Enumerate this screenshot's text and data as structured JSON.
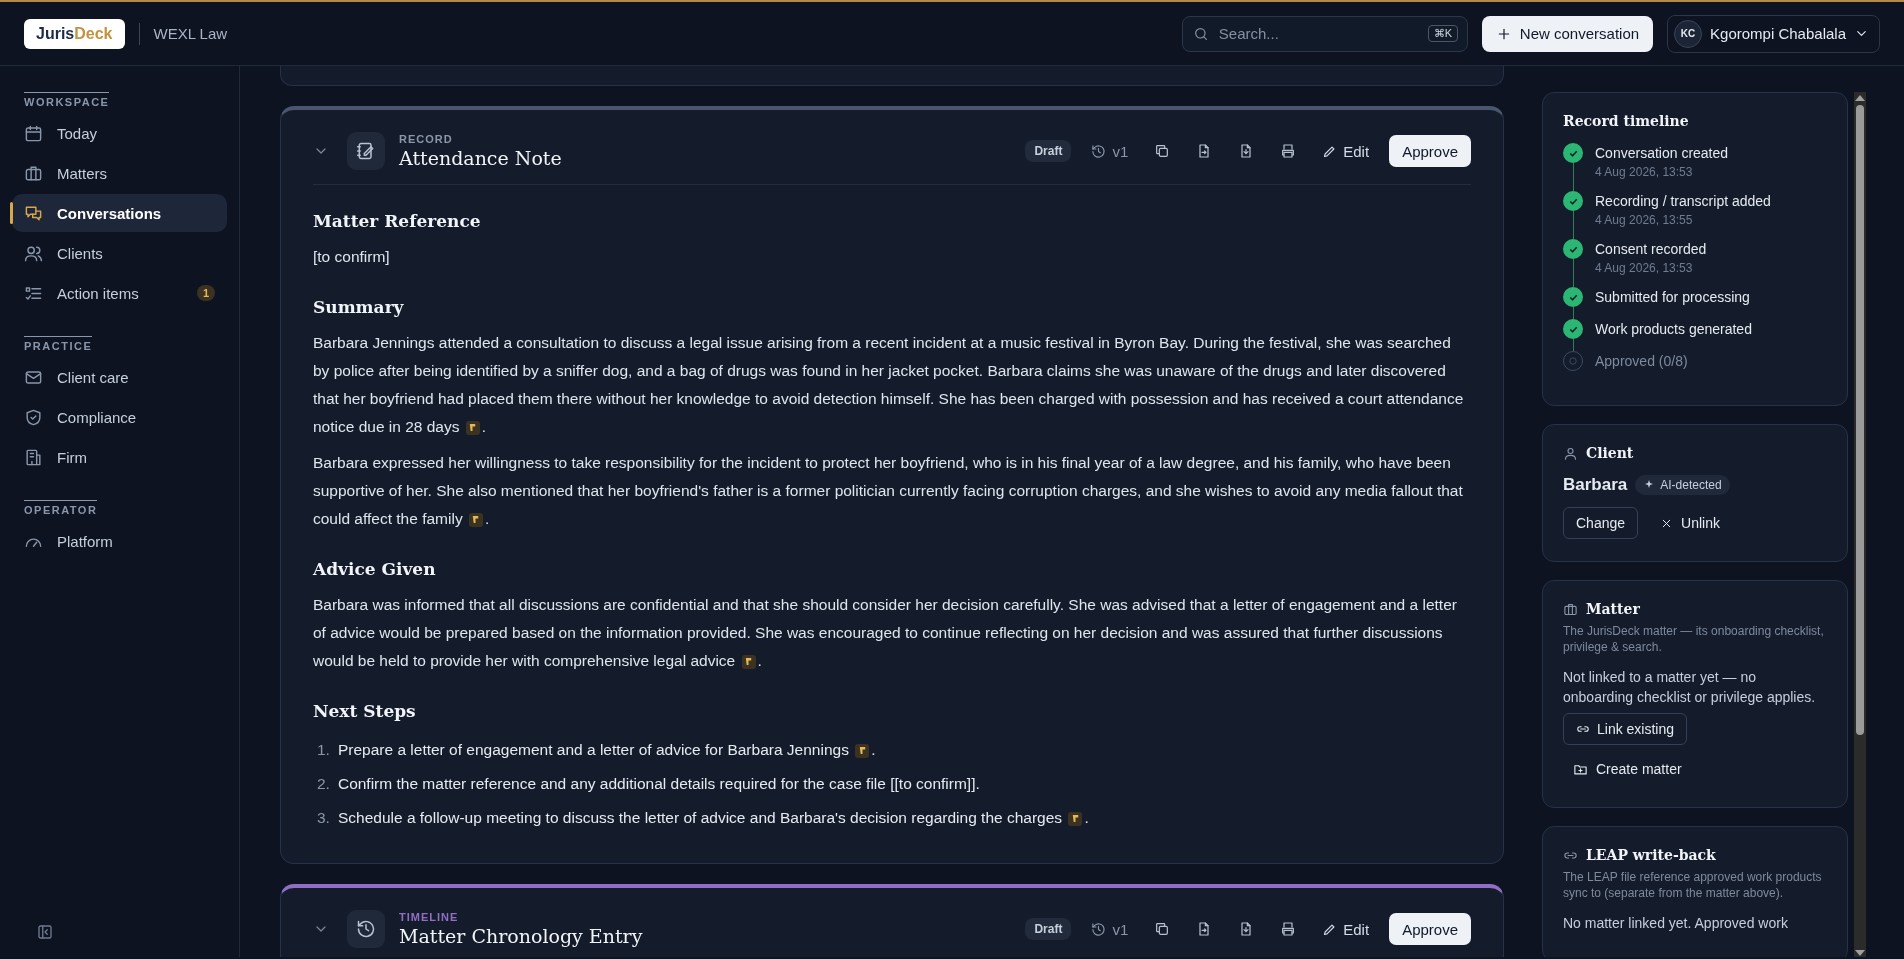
{
  "header": {
    "logo": {
      "part_1": "Juris",
      "part_2": "Deck"
    },
    "firm": "WEXL Law",
    "search": {
      "placeholder": "Search...",
      "shortcut": "⌘K"
    },
    "new_button": "New conversation",
    "user": {
      "initials": "KC",
      "name": "Kgorompi Chabalala"
    }
  },
  "sidebar": {
    "sections": [
      {
        "label": "WORKSPACE",
        "items": [
          {
            "label": "Today",
            "selected": false
          },
          {
            "label": "Matters",
            "selected": false
          },
          {
            "label": "Conversations",
            "selected": true
          },
          {
            "label": "Clients",
            "selected": false
          },
          {
            "label": "Action items",
            "selected": false,
            "badge": "1"
          }
        ]
      },
      {
        "label": "PRACTICE",
        "items": [
          {
            "label": "Client care",
            "selected": false
          },
          {
            "label": "Compliance",
            "selected": false
          },
          {
            "label": "Firm",
            "selected": false
          }
        ]
      },
      {
        "label": "OPERATOR",
        "items": [
          {
            "label": "Platform",
            "selected": false
          }
        ]
      }
    ]
  },
  "cards": [
    {
      "type_label": "RECORD",
      "title": "Attendance Note",
      "color": "#4a566e",
      "status": "Draft",
      "version": "v1",
      "edit": "Edit",
      "approve": "Approve",
      "sections": [
        {
          "heading": "Matter Reference",
          "paragraphs": [
            {
              "text": "[to confirm]",
              "source_marker": false
            }
          ]
        },
        {
          "heading": "Summary",
          "paragraphs": [
            {
              "text": "Barbara Jennings attended a consultation to discuss a legal issue arising from a recent incident at a music festival in Byron Bay. During the festival, she was searched by police after being identified by a sniffer dog, and a bag of drugs was found in her jacket pocket. Barbara claims she was unaware of the drugs and later discovered that her boyfriend had placed them there without her knowledge to avoid detection himself. She has been charged with possession and has received a court attendance notice due in 28 days",
              "source_marker": true,
              "text_after": "."
            },
            {
              "text": "Barbara expressed her willingness to take responsibility for the incident to protect her boyfriend, who is in his final year of a law degree, and his family, who have been supportive of her. She also mentioned that her boyfriend's father is a former politician currently facing corruption charges, and she wishes to avoid any media fallout that could affect the family",
              "source_marker": true,
              "text_after": "."
            }
          ]
        },
        {
          "heading": "Advice Given",
          "paragraphs": [
            {
              "text": "Barbara was informed that all discussions are confidential and that she should consider her decision carefully. She was advised that a letter of engagement and a letter of advice would be prepared based on the information provided. She was encouraged to continue reflecting on her decision and was assured that further discussions would be held to provide her with comprehensive legal advice",
              "source_marker": true,
              "text_after": "."
            }
          ]
        },
        {
          "heading": "Next Steps",
          "list": [
            {
              "number": "1.",
              "text": "Prepare a letter of engagement and a letter of advice for Barbara Jennings",
              "source_marker": true,
              "text_after": "."
            },
            {
              "number": "2.",
              "text": "Confirm the matter reference and any additional details required for the case file [[to confirm]].",
              "source_marker": false
            },
            {
              "number": "3.",
              "text": "Schedule a follow-up meeting to discuss the letter of advice and Barbara's decision regarding the charges",
              "source_marker": true,
              "text_after": "."
            }
          ]
        }
      ]
    },
    {
      "type_label": "TIMELINE",
      "title": "Matter Chronology Entry",
      "color": "#8e6fc4",
      "status": "Draft",
      "version": "v1",
      "edit": "Edit",
      "approve": "Approve"
    }
  ],
  "right_panel": {
    "timeline": {
      "title": "Record timeline",
      "steps": [
        {
          "label": "Conversation created",
          "time": "4 Aug 2026, 13:53",
          "done": true
        },
        {
          "label": "Recording / transcript added",
          "time": "4 Aug 2026, 13:55",
          "done": true
        },
        {
          "label": "Consent recorded",
          "time": "4 Aug 2026, 13:53",
          "done": true
        },
        {
          "label": "Submitted for processing",
          "done": true
        },
        {
          "label": "Work products generated",
          "done": true
        },
        {
          "label": "Approved (0/8)",
          "done": false
        }
      ]
    },
    "client": {
      "title": "Client",
      "name": "Barbara",
      "tag": "AI-detected",
      "change": "Change",
      "unlink": "Unlink"
    },
    "matter": {
      "title": "Matter",
      "description": "The JurisDeck matter — its onboarding checklist, privilege & search.",
      "status": "Not linked to a matter yet — no onboarding checklist or privilege applies.",
      "link": "Link existing",
      "create": "Create matter"
    },
    "leap": {
      "title": "LEAP write-back",
      "description": "The LEAP file reference approved work products sync to (separate from the matter above).",
      "status": "No matter linked yet. Approved work"
    }
  }
}
